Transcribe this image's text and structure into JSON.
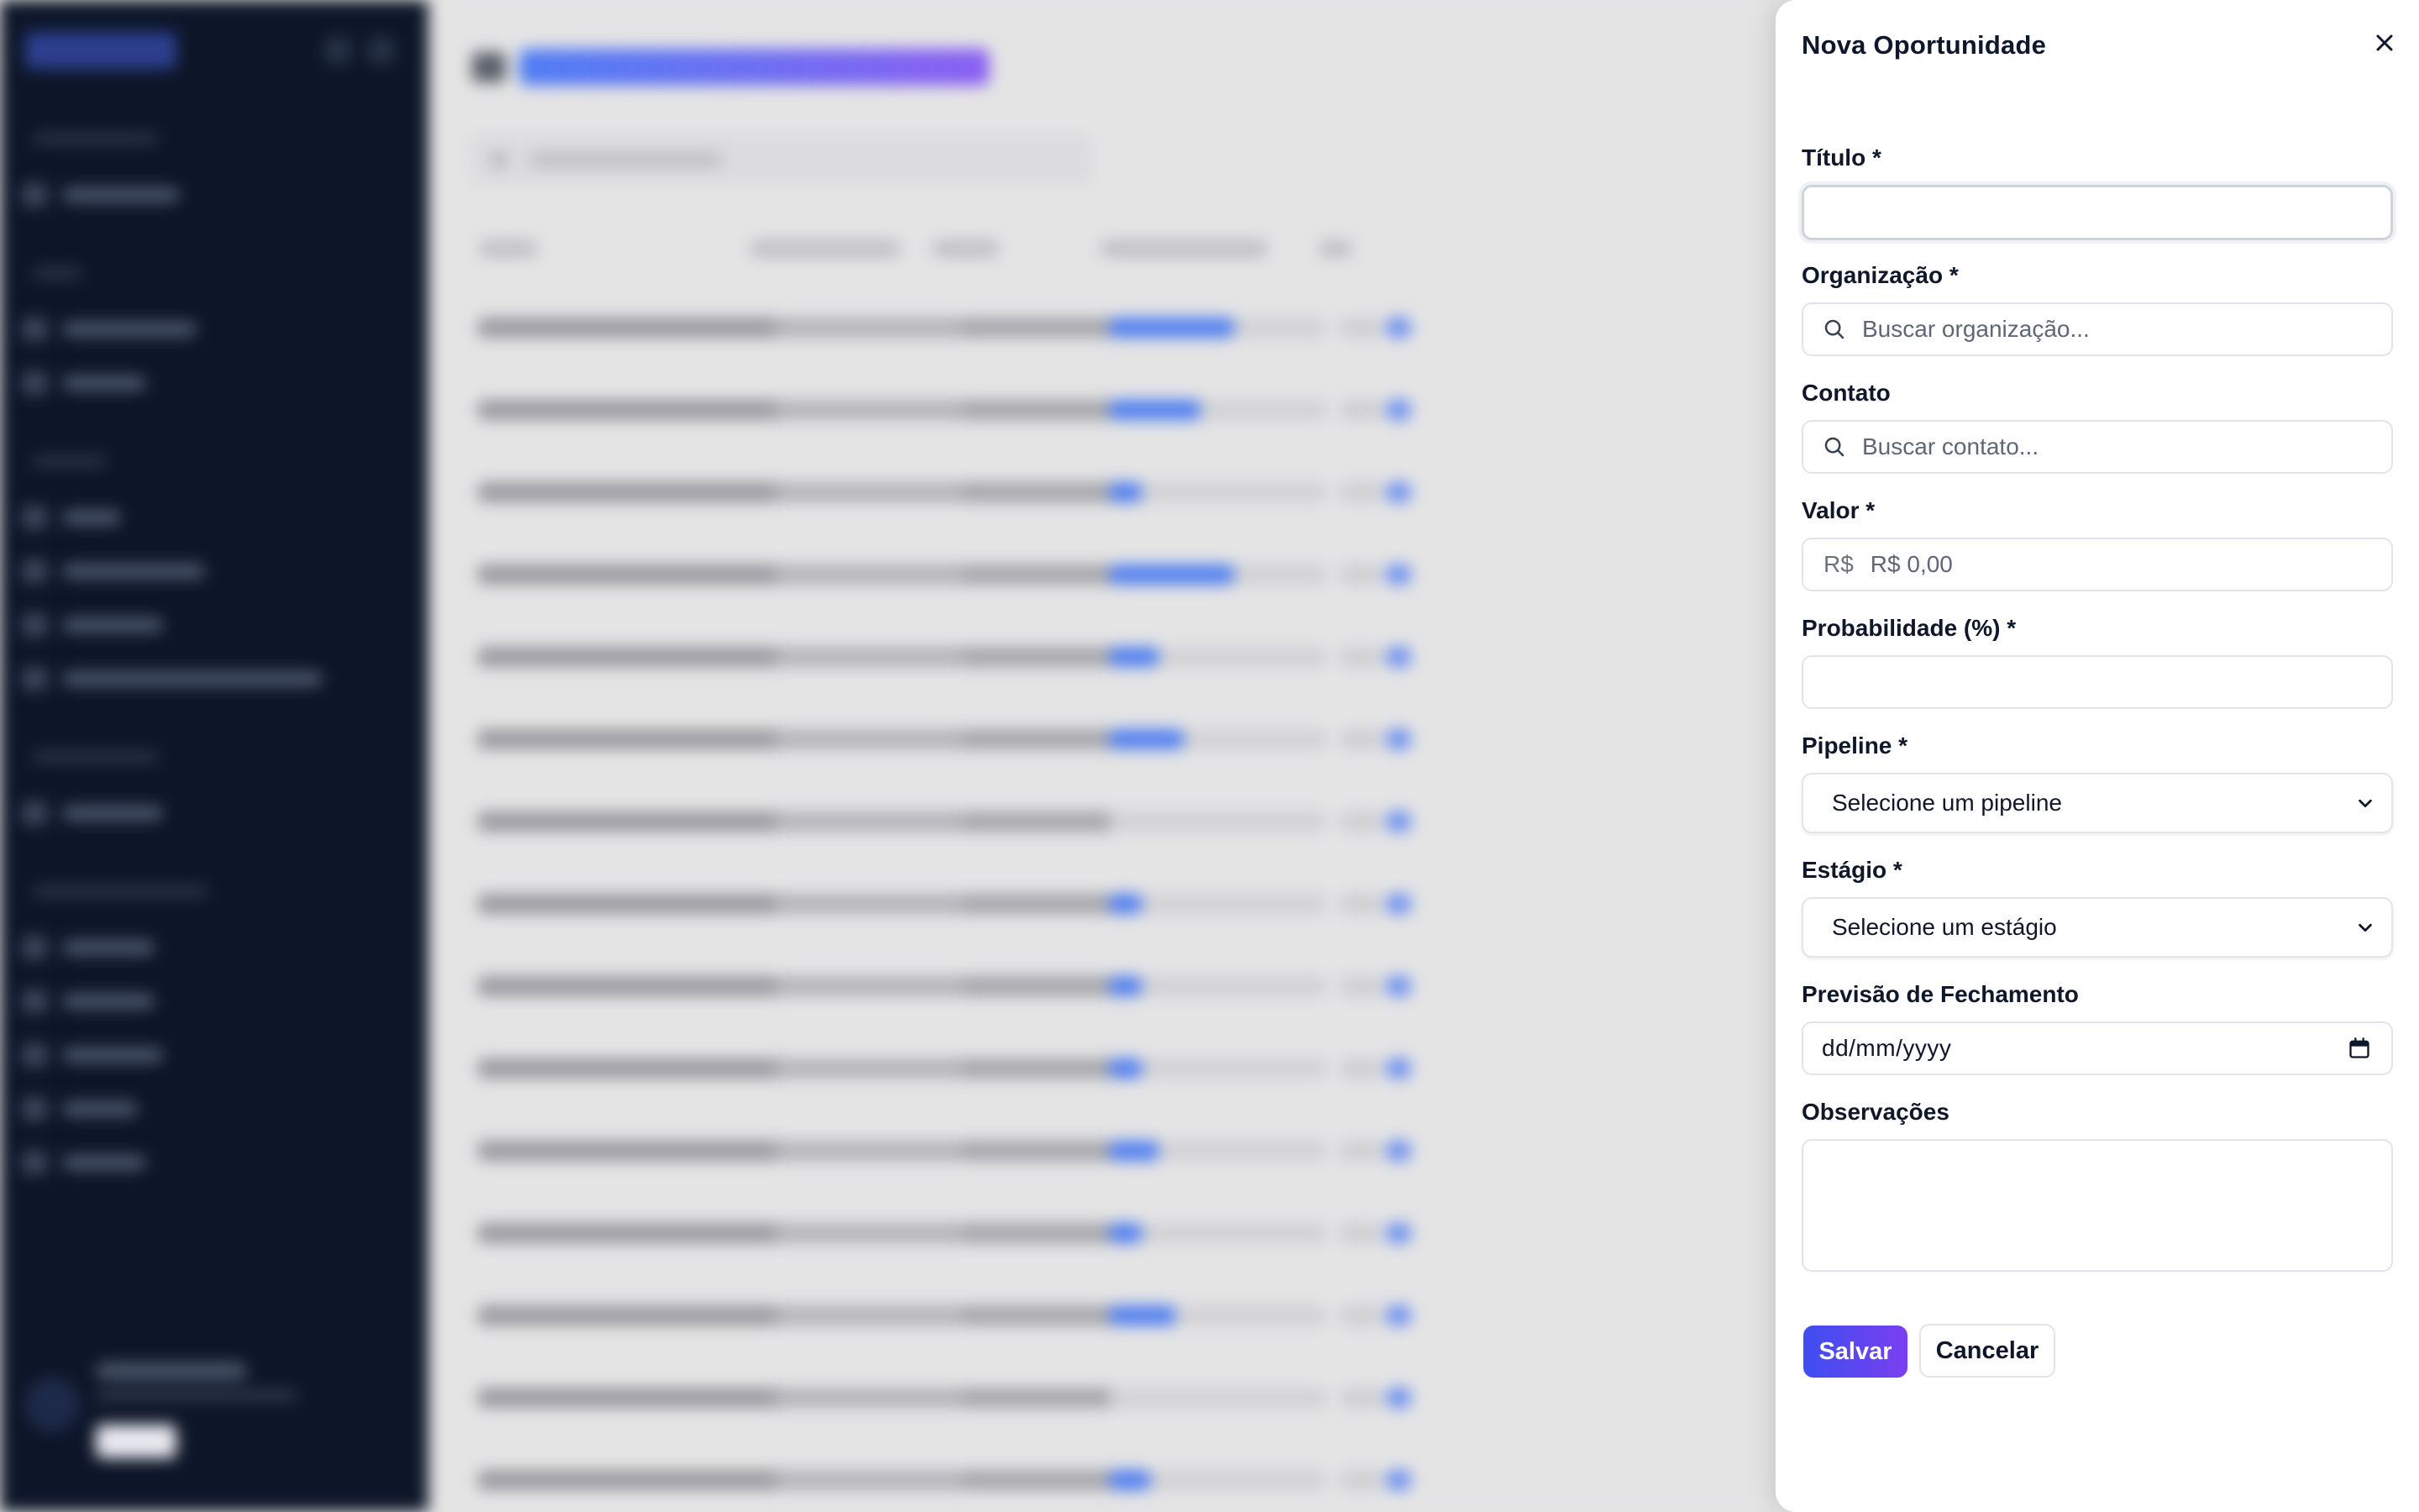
{
  "drawer": {
    "title": "Nova Oportunidade",
    "close_icon": "close-icon",
    "fields": {
      "titulo": {
        "label": "Título *",
        "value": ""
      },
      "organizacao": {
        "label": "Organização *",
        "placeholder": "Buscar organização..."
      },
      "contato": {
        "label": "Contato",
        "placeholder": "Buscar contato..."
      },
      "valor": {
        "label": "Valor *",
        "prefix": "R$",
        "placeholder": "R$ 0,00"
      },
      "probabilidade": {
        "label": "Probabilidade (%) *",
        "value": ""
      },
      "pipeline": {
        "label": "Pipeline *",
        "selected": "Selecione um pipeline"
      },
      "estagio": {
        "label": "Estágio *",
        "selected": "Selecione um estágio"
      },
      "previsao": {
        "label": "Previsão de Fechamento",
        "value": "dd/mm/yyyy"
      },
      "observacoes": {
        "label": "Observações",
        "value": ""
      }
    },
    "buttons": {
      "save": "Salvar",
      "cancel": "Cancelar"
    }
  },
  "colors": {
    "accent_start": "#3d4ef0",
    "accent_end": "#7b3ff0",
    "sidebar_bg": "#0d1628",
    "drawer_bg": "#ffffff"
  }
}
